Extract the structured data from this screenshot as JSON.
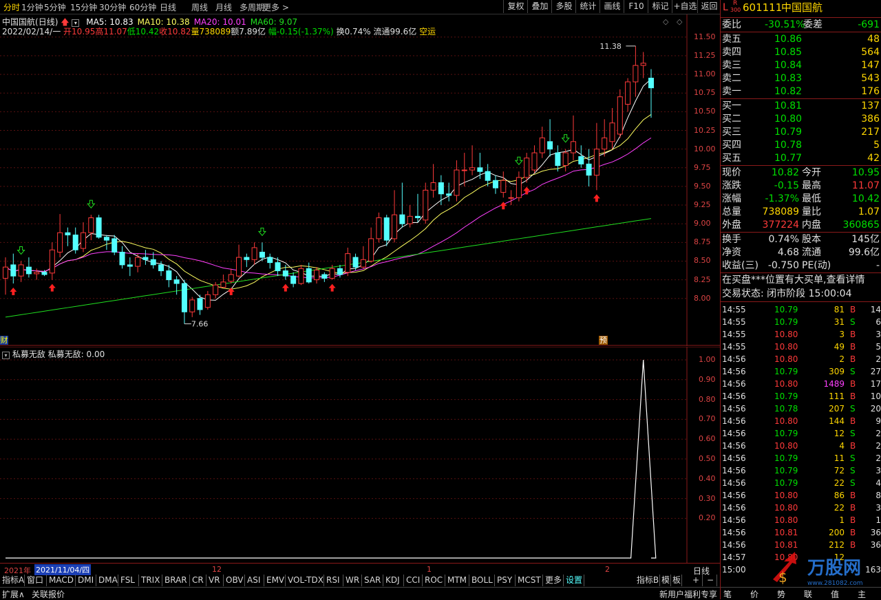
{
  "periods": [
    "分时",
    "1分钟",
    "5分钟",
    "15分钟",
    "30分钟",
    "60分钟",
    "日线",
    "周线",
    "月线",
    "多周期",
    "更多 >"
  ],
  "toolbar": [
    "复权",
    "叠加",
    "多股",
    "统计",
    "画线",
    "F10",
    "标记",
    "+自选",
    "返回"
  ],
  "stock": {
    "name": "中国国航",
    "code": "601111",
    "period_label": "(日线)",
    "market_badge": "L",
    "r_badge": "R",
    "r_sub": "300"
  },
  "ma_legend": [
    {
      "label": "MA5: 10.83",
      "color": "#ffffff"
    },
    {
      "label": "MA10: 10.38",
      "color": "#ffff60"
    },
    {
      "label": "MA20: 10.01",
      "color": "#ff40ff"
    },
    {
      "label": "MA60: 9.07",
      "color": "#20e020"
    }
  ],
  "info_line": {
    "date": "2022/02/14/一",
    "open": "开10.95",
    "high": "高11.07",
    "low": "低10.42",
    "close": "收10.82",
    "vol": "量738089",
    "amount": "额7.89亿",
    "amp": "幅-0.15(-1.37%)",
    "turnover": "换0.74%",
    "float": "流通99.6亿",
    "signal": "空运"
  },
  "price_axis": [
    "11.50",
    "11.25",
    "11.00",
    "10.75",
    "10.50",
    "10.25",
    "10.00",
    "9.75",
    "9.50",
    "9.25",
    "9.00",
    "8.75",
    "8.50",
    "8.25",
    "8.00"
  ],
  "high_mark": "11.38",
  "low_mark": "7.66",
  "cai_badge": "财",
  "yu_badge": "预",
  "indicator": {
    "title": "私募无敌",
    "value_label": "私募无敌: 0.00",
    "axis": [
      "1.00",
      "0.90",
      "0.80",
      "0.70",
      "0.60",
      "0.50",
      "0.40",
      "0.30",
      "0.20"
    ]
  },
  "time_axis": {
    "year": "2021年",
    "cursor": "2021/11/04/四",
    "t12": "12",
    "t1": "1",
    "t2": "2",
    "mode": "日线"
  },
  "bottom_tabs": [
    "指标A",
    "窗口",
    "MACD",
    "DMI",
    "DMA",
    "FSL",
    "TRIX",
    "BRAR",
    "CR",
    "VR",
    "OBV",
    "ASI",
    "EMV",
    "VOL-TDX",
    "RSI",
    "WR",
    "SAR",
    "KDJ",
    "CCI",
    "ROC",
    "MTM",
    "BOLL",
    "PSY",
    "MCST",
    "更多",
    "设置"
  ],
  "bottom_right": [
    "指标B",
    "模",
    "板",
    "+",
    "−"
  ],
  "status_left": [
    "扩展∧",
    "关联报价"
  ],
  "status_right": "新用户福利专享",
  "chart_data": {
    "type": "candlestick",
    "title": "中国国航(日线)",
    "ylim": [
      7.5,
      11.6
    ],
    "candles": [
      [
        8.27,
        8.42,
        8.55,
        8.05
      ],
      [
        8.45,
        8.3,
        8.6,
        8.2
      ],
      [
        8.3,
        8.45,
        8.5,
        8.22
      ],
      [
        8.42,
        8.33,
        8.55,
        8.28
      ],
      [
        8.33,
        8.35,
        8.4,
        8.25
      ],
      [
        8.35,
        8.32,
        8.38,
        8.3
      ],
      [
        8.34,
        8.65,
        8.75,
        8.25
      ],
      [
        8.62,
        8.88,
        9.13,
        8.55
      ],
      [
        8.88,
        8.85,
        8.95,
        8.7
      ],
      [
        8.85,
        8.65,
        8.95,
        8.6
      ],
      [
        8.67,
        8.88,
        9.02,
        8.62
      ],
      [
        8.88,
        9.08,
        9.12,
        8.78
      ],
      [
        9.08,
        8.82,
        9.12,
        8.8
      ],
      [
        8.82,
        8.78,
        8.85,
        8.65
      ],
      [
        8.8,
        8.62,
        8.85,
        8.58
      ],
      [
        8.62,
        8.45,
        8.7,
        8.4
      ],
      [
        8.45,
        8.43,
        8.55,
        8.3
      ],
      [
        8.43,
        8.55,
        8.6,
        8.35
      ],
      [
        8.55,
        8.52,
        8.65,
        8.45
      ],
      [
        8.52,
        8.45,
        8.62,
        8.4
      ],
      [
        8.45,
        8.37,
        8.5,
        8.3
      ],
      [
        8.37,
        8.25,
        8.45,
        8.15
      ],
      [
        8.25,
        8.2,
        8.3,
        8.05
      ],
      [
        8.2,
        7.82,
        8.25,
        7.66
      ],
      [
        7.82,
        7.98,
        8.02,
        7.75
      ],
      [
        8.0,
        7.85,
        8.05,
        7.78
      ],
      [
        7.88,
        8.05,
        8.1,
        7.85
      ],
      [
        8.05,
        8.18,
        8.22,
        8.0
      ],
      [
        8.15,
        8.22,
        8.32,
        8.15
      ],
      [
        8.23,
        8.32,
        8.4,
        8.2
      ],
      [
        8.3,
        8.55,
        8.72,
        8.28
      ],
      [
        8.55,
        8.52,
        8.6,
        8.42
      ],
      [
        8.52,
        8.68,
        8.75,
        8.45
      ],
      [
        8.62,
        8.55,
        8.75,
        8.5
      ],
      [
        8.55,
        8.48,
        8.6,
        8.4
      ],
      [
        8.48,
        8.37,
        8.55,
        8.3
      ],
      [
        8.37,
        8.3,
        8.45,
        8.25
      ],
      [
        8.3,
        8.2,
        8.35,
        8.15
      ],
      [
        8.2,
        8.4,
        8.45,
        8.18
      ],
      [
        8.4,
        8.22,
        8.48,
        8.2
      ],
      [
        8.25,
        8.38,
        8.42,
        8.2
      ],
      [
        8.32,
        8.27,
        8.35,
        8.22
      ],
      [
        8.27,
        8.4,
        8.45,
        8.25
      ],
      [
        8.4,
        8.32,
        8.45,
        8.28
      ],
      [
        8.35,
        8.6,
        8.68,
        8.3
      ],
      [
        8.55,
        8.42,
        8.6,
        8.38
      ],
      [
        8.42,
        8.52,
        8.7,
        8.4
      ],
      [
        8.5,
        8.8,
        8.95,
        8.48
      ],
      [
        8.8,
        9.08,
        9.15,
        8.75
      ],
      [
        9.08,
        8.78,
        9.12,
        8.7
      ],
      [
        8.8,
        9.12,
        9.45,
        8.75
      ],
      [
        9.12,
        9.0,
        9.55,
        8.95
      ],
      [
        9.0,
        9.1,
        9.25,
        8.95
      ],
      [
        9.1,
        9.08,
        9.4,
        9.02
      ],
      [
        9.05,
        9.45,
        9.55,
        9.0
      ],
      [
        9.45,
        9.55,
        9.8,
        9.35
      ],
      [
        9.55,
        9.4,
        9.65,
        9.25
      ],
      [
        9.4,
        9.38,
        9.55,
        9.3
      ],
      [
        9.38,
        9.72,
        9.85,
        9.3
      ],
      [
        9.72,
        9.72,
        9.95,
        9.5
      ],
      [
        9.72,
        9.75,
        10.05,
        9.65
      ],
      [
        9.75,
        9.7,
        9.95,
        9.6
      ],
      [
        9.7,
        9.58,
        9.8,
        9.5
      ],
      [
        9.58,
        9.48,
        9.65,
        9.4
      ],
      [
        9.42,
        9.58,
        9.7,
        9.35
      ],
      [
        9.35,
        9.35,
        9.45,
        9.25
      ],
      [
        9.35,
        9.62,
        9.7,
        9.3
      ],
      [
        9.62,
        9.88,
        9.95,
        9.55
      ],
      [
        9.72,
        9.95,
        10.05,
        9.68
      ],
      [
        9.95,
        10.15,
        10.3,
        9.88
      ],
      [
        10.1,
        10.0,
        10.4,
        9.9
      ],
      [
        9.95,
        9.78,
        10.05,
        9.7
      ],
      [
        9.78,
        9.95,
        10.0,
        9.7
      ],
      [
        9.95,
        10.1,
        10.45,
        9.85
      ],
      [
        9.9,
        9.8,
        10.05,
        9.75
      ],
      [
        9.8,
        9.65,
        10.0,
        9.5
      ],
      [
        9.65,
        10.0,
        10.35,
        9.45
      ],
      [
        10.0,
        10.15,
        10.4,
        9.9
      ],
      [
        10.1,
        10.35,
        10.55,
        10.0
      ],
      [
        10.2,
        10.7,
        10.8,
        10.15
      ],
      [
        10.6,
        10.9,
        10.95,
        10.5
      ],
      [
        10.9,
        11.12,
        11.38,
        10.7
      ],
      [
        11.12,
        11.15,
        11.3,
        10.95
      ],
      [
        10.95,
        10.82,
        11.07,
        10.42
      ]
    ],
    "signals": [
      {
        "bar": 1,
        "type": "buy"
      },
      {
        "bar": 2,
        "type": "sell"
      },
      {
        "bar": 6,
        "type": "buy"
      },
      {
        "bar": 11,
        "type": "sell"
      },
      {
        "bar": 29,
        "type": "buy"
      },
      {
        "bar": 33,
        "type": "sell"
      },
      {
        "bar": 36,
        "type": "buy"
      },
      {
        "bar": 42,
        "type": "buy"
      },
      {
        "bar": 64,
        "type": "buy"
      },
      {
        "bar": 66,
        "type": "sell"
      },
      {
        "bar": 67,
        "type": "buy"
      },
      {
        "bar": 72,
        "type": "sell"
      },
      {
        "bar": 76,
        "type": "buy"
      }
    ],
    "indicator_spike": {
      "bar": 82,
      "value": 1.0
    }
  },
  "quote": {
    "webi": {
      "label": "委比",
      "val": "-30.51%",
      "label2": "委差",
      "val2": "-691"
    },
    "sells": [
      {
        "label": "卖五",
        "price": "10.86",
        "vol": "48"
      },
      {
        "label": "卖四",
        "price": "10.85",
        "vol": "564"
      },
      {
        "label": "卖三",
        "price": "10.84",
        "vol": "147"
      },
      {
        "label": "卖二",
        "price": "10.83",
        "vol": "543"
      },
      {
        "label": "卖一",
        "price": "10.82",
        "vol": "176"
      }
    ],
    "buys": [
      {
        "label": "买一",
        "price": "10.81",
        "vol": "137"
      },
      {
        "label": "买二",
        "price": "10.80",
        "vol": "386"
      },
      {
        "label": "买三",
        "price": "10.79",
        "vol": "217"
      },
      {
        "label": "买四",
        "price": "10.78",
        "vol": "5"
      },
      {
        "label": "买五",
        "price": "10.77",
        "vol": "42"
      }
    ],
    "stats": [
      {
        "l1": "现价",
        "v1": "10.82",
        "l2": "今开",
        "v2": "10.95"
      },
      {
        "l1": "涨跌",
        "v1": "-0.15",
        "l2": "最高",
        "v2": "11.07"
      },
      {
        "l1": "涨幅",
        "v1": "-1.37%",
        "l2": "最低",
        "v2": "10.42"
      },
      {
        "l1": "总量",
        "v1": "738089",
        "l2": "量比",
        "v2": "1.07"
      },
      {
        "l1": "外盘",
        "v1": "377224",
        "l2": "内盘",
        "v2": "360865"
      }
    ],
    "stats2": [
      {
        "l1": "换手",
        "v1": "0.74%",
        "l2": "股本",
        "v2": "145亿"
      },
      {
        "l1": "净资",
        "v1": "4.68",
        "l2": "流通",
        "v2": "99.6亿"
      },
      {
        "l1": "收益(三)",
        "v1": "-0.750",
        "l2": "PE(动)",
        "v2": "-"
      }
    ],
    "notice": "在买盘***位置有大买单,查看详情",
    "trade_status": "交易状态: 闭市阶段 15:00:04"
  },
  "trades": [
    [
      "14:55",
      "10.79",
      "81",
      "B",
      "14"
    ],
    [
      "14:55",
      "10.79",
      "31",
      "S",
      "6"
    ],
    [
      "14:55",
      "10.80",
      "3",
      "B",
      "3"
    ],
    [
      "14:55",
      "10.80",
      "49",
      "B",
      "5"
    ],
    [
      "14:56",
      "10.80",
      "2",
      "B",
      "2"
    ],
    [
      "14:56",
      "10.79",
      "309",
      "S",
      "27"
    ],
    [
      "14:56",
      "10.80",
      "1489",
      "B",
      "17"
    ],
    [
      "14:56",
      "10.79",
      "111",
      "B",
      "10"
    ],
    [
      "14:56",
      "10.78",
      "207",
      "S",
      "20"
    ],
    [
      "14:56",
      "10.80",
      "144",
      "B",
      "9"
    ],
    [
      "14:56",
      "10.79",
      "12",
      "S",
      "2"
    ],
    [
      "14:56",
      "10.80",
      "4",
      "B",
      "2"
    ],
    [
      "14:56",
      "10.79",
      "11",
      "S",
      "2"
    ],
    [
      "14:56",
      "10.79",
      "72",
      "S",
      "3"
    ],
    [
      "14:56",
      "10.79",
      "22",
      "S",
      "4"
    ],
    [
      "14:56",
      "10.80",
      "86",
      "B",
      "8"
    ],
    [
      "14:56",
      "10.80",
      "22",
      "B",
      "3"
    ],
    [
      "14:56",
      "10.80",
      "1",
      "B",
      "1"
    ],
    [
      "14:56",
      "10.81",
      "200",
      "B",
      "36"
    ],
    [
      "14:56",
      "10.81",
      "212",
      "B",
      "36"
    ],
    [
      "14:57",
      "10.80",
      "12",
      "",
      ""
    ],
    [
      "15:00",
      "",
      "",
      "",
      "163"
    ]
  ],
  "bottom_quote_tabs": [
    "笔",
    "价",
    "势",
    "联",
    "值",
    "主"
  ],
  "watermark": "万股网 www.281082.com"
}
